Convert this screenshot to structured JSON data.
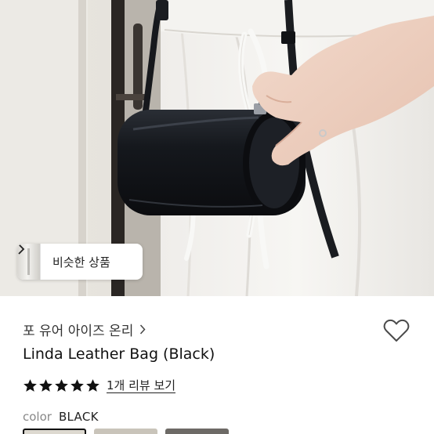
{
  "similar_button": {
    "label": "비슷한 상품"
  },
  "brand": {
    "name": "포 유어 아이즈 온리"
  },
  "product": {
    "title": "Linda Leather Bag (Black)"
  },
  "rating": {
    "stars": 5,
    "max_stars": 5,
    "review_text": "1개 리뷰 보기"
  },
  "color_option": {
    "label": "color",
    "value": "BLACK"
  },
  "colors": {
    "star": "#111111",
    "bag": "#15181d",
    "background": "#ffffff",
    "muted_text": "#888888"
  },
  "icons": {
    "similar_chevron": "chevron-right-icon",
    "brand_chevron": "chevron-right-icon",
    "wishlist": "heart-outline-icon",
    "rating": "star-icon"
  }
}
